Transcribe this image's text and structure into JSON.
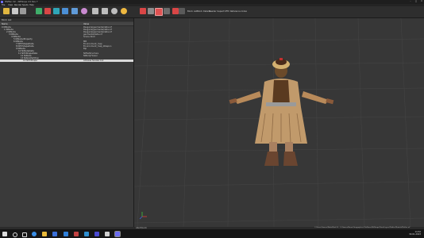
{
  "window": {
    "title": "Pfaffen.mh - Nif5kope 2.0 Dev 7",
    "controls": {
      "minimize": "–",
      "maximize": "□",
      "close": "✕"
    }
  },
  "menu": [
    "File",
    "View",
    "Render",
    "Spells",
    "Help"
  ],
  "toolbar": {
    "labels": [
      "Block List",
      "Block Details",
      "Header",
      "Inspect",
      "KFM",
      "Reference Index"
    ]
  },
  "panel": {
    "title": "Block List",
    "columns": {
      "name": "Name",
      "value": "Value"
    },
    "rows": [
      {
        "indent": 0,
        "name": "0 NiNode",
        "value": "Paugaria/geomedia/data.nif",
        "selected": false
      },
      {
        "indent": 1,
        "name": "1 NiNode",
        "value": "Paugaria/geomedia/data.nif",
        "selected": false
      },
      {
        "indent": 2,
        "name": "2 NiNode",
        "value": "Paugaria/geomedia/data.nif",
        "selected": false
      },
      {
        "indent": 3,
        "name": "3 NiNode",
        "value": "geomedia/data.nif",
        "selected": false
      },
      {
        "indent": 4,
        "name": "4 NiNode",
        "value": "Scene Root",
        "selected": false
      },
      {
        "indent": 5,
        "name": "5 NiNode/Property",
        "value": "",
        "selected": false
      },
      {
        "indent": 5,
        "name": "6 NiNode",
        "value": "MB",
        "selected": false
      },
      {
        "indent": 6,
        "name": "7 NiTriShapeData",
        "value": "Environment_map",
        "selected": false
      },
      {
        "indent": 6,
        "name": "8 NiTriShapeData",
        "value": "Environment_map_Weapon",
        "selected": false
      },
      {
        "indent": 6,
        "name": "9 NiNode",
        "value": "Bip",
        "selected": false
      },
      {
        "indent": 7,
        "name": "10 NiNodeData",
        "value": "",
        "selected": false
      },
      {
        "indent": 7,
        "name": "11 NiTriShapeData",
        "value": "NiFileStructure",
        "selected": false
      },
      {
        "indent": 8,
        "name": "12 NiNode",
        "value": "NiBodyFlower",
        "selected": false
      },
      {
        "indent": 8,
        "name": "13 NiSkinPartition",
        "value": "",
        "selected": false
      },
      {
        "indent": 9,
        "name": "14 NiTriShape",
        "value": "Adresse fenster:0,0",
        "selected": true
      }
    ]
  },
  "status": {
    "left": "Abort/Lock",
    "right": "C:/Users/Games/Mods/Mod 03 - O:/Games/Rome/Geographical Fis/Rome/NifSkope/Data/Layers/Pfaffen/Models/Pfaffen.nif"
  },
  "taskbar": {
    "time": "14:52",
    "date": "30.01.2023"
  },
  "colors": {
    "accent": "#d8d8d8",
    "selection": "#d9d9d9",
    "viewport": "#373737"
  },
  "icons": [
    "app-icon",
    "open-file-icon",
    "save-icon",
    "load-icon",
    "cursor-icon",
    "rotate-icon",
    "flip-icon",
    "texture-icon",
    "mesh-icon",
    "light-icon",
    "camera-icon",
    "play-icon",
    "help-icon",
    "windows-start-icon",
    "search-icon",
    "task-view-icon",
    "browser-icon",
    "folder-icon",
    "store-icon",
    "mail-icon",
    "steam-icon",
    "nifskope-icon"
  ]
}
